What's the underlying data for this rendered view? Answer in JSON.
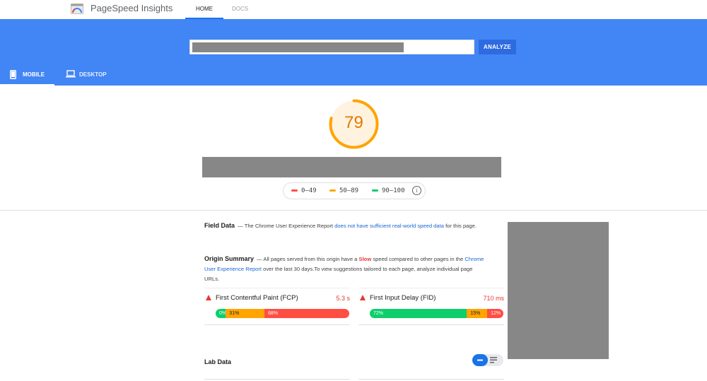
{
  "topbar": {
    "brand": "PageSpeed Insights",
    "nav": [
      {
        "label": "HOME",
        "active": true
      },
      {
        "label": "DOCS",
        "active": false
      }
    ]
  },
  "search": {
    "value": "",
    "button_label": "ANALYZE"
  },
  "device_tabs": [
    {
      "label": "MOBILE",
      "icon": "smartphone-icon",
      "active": true
    },
    {
      "label": "DESKTOP",
      "icon": "laptop-icon",
      "active": false
    }
  ],
  "score": {
    "value": "79",
    "fraction": 0.79,
    "color": "#ffa400"
  },
  "legend": [
    {
      "label": "0–49",
      "color": "#ff4e42"
    },
    {
      "label": "50–89",
      "color": "#ffa400"
    },
    {
      "label": "90–100",
      "color": "#0cce6b"
    }
  ],
  "field_data": {
    "title": "Field Data",
    "prefix": " — The Chrome User Experience Report ",
    "link": "does not have sufficient real-world speed data",
    "suffix": " for this page."
  },
  "origin_summary": {
    "title": "Origin Summary",
    "prefix": " — All pages served from this origin have a ",
    "slow": "Slow",
    "mid": " speed compared to other pages in the ",
    "link": "Chrome User Experience Report",
    "suffix": " over the last 30 days.To view suggestions tailored to each page, analyze individual page URLs."
  },
  "metrics": [
    {
      "name": "First Contentful Paint (FCP)",
      "value": "5.3 s",
      "dist": [
        {
          "label": "0%",
          "fraction": 0.0
        },
        {
          "label": "31%",
          "fraction": 0.31
        },
        {
          "label": "68%",
          "fraction": 0.68
        }
      ]
    },
    {
      "name": "First Input Delay (FID)",
      "value": "710 ms",
      "dist": [
        {
          "label": "72%",
          "fraction": 0.72
        },
        {
          "label": "15%",
          "fraction": 0.15
        },
        {
          "label": "12%",
          "fraction": 0.12
        }
      ]
    }
  ],
  "lab_data": {
    "title": "Lab Data"
  }
}
